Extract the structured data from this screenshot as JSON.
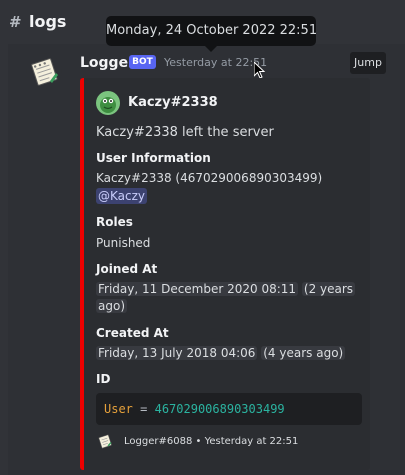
{
  "channel": {
    "name": "logs"
  },
  "tooltip": {
    "text": "Monday, 24 October 2022 22:51"
  },
  "message": {
    "author": "Logger",
    "badge": "BOT",
    "timestamp": "Yesterday at 22:51",
    "jump_label": "Jump"
  },
  "embed": {
    "accent_color": "#ed0000",
    "author": "Kaczy#2338",
    "description": "Kaczy#2338 left the server",
    "fields": [
      {
        "name": "User Information",
        "value_line1": "Kaczy#2338 (467029006890303499)",
        "mention": "@Kaczy"
      },
      {
        "name": "Roles",
        "value": "Punished"
      },
      {
        "name": "Joined At",
        "date": "Friday, 11 December 2020 08:11",
        "relative_a": "(2 years",
        "relative_b": "ago)"
      },
      {
        "name": "Created At",
        "date": "Friday, 13 July 2018 04:06",
        "relative": "(4 years ago)"
      },
      {
        "name": "ID",
        "code_key": "User",
        "code_op": "=",
        "code_value": "467029006890303499"
      }
    ],
    "footer": {
      "text": "Logger#6088",
      "separator": "•",
      "timestamp": "Yesterday at 22:51"
    }
  }
}
